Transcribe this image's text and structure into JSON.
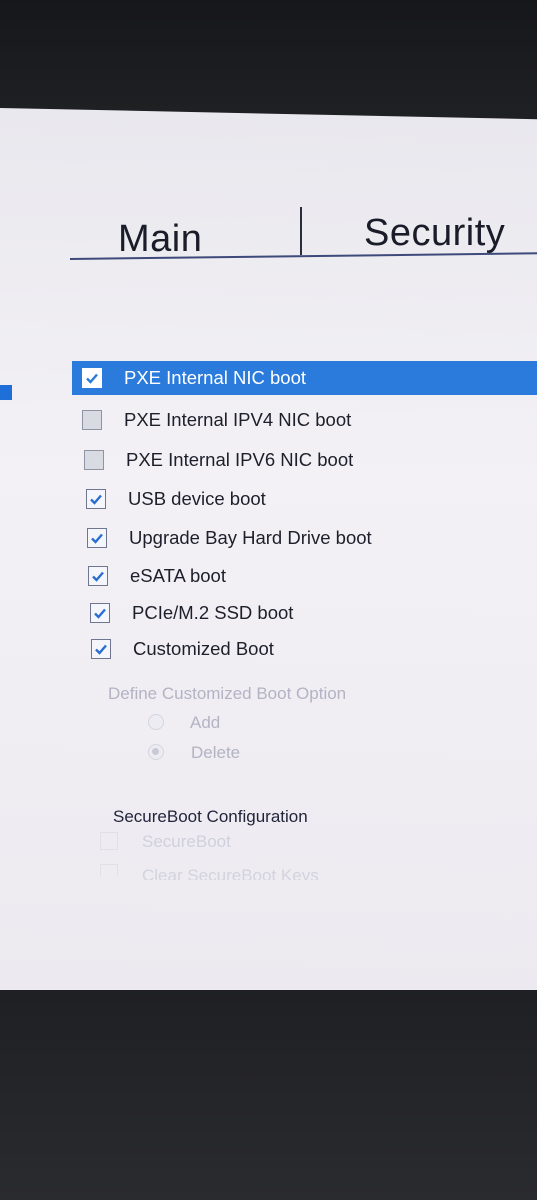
{
  "tabs": {
    "main": "Main",
    "security": "Security"
  },
  "boot_options": [
    {
      "label": "PXE Internal NIC boot",
      "checked": true,
      "selected": true
    },
    {
      "label": "PXE Internal IPV4 NIC boot",
      "checked": false,
      "selected": false
    },
    {
      "label": "PXE Internal IPV6 NIC boot",
      "checked": false,
      "selected": false
    },
    {
      "label": "USB device boot",
      "checked": true,
      "selected": false
    },
    {
      "label": "Upgrade Bay Hard Drive boot",
      "checked": true,
      "selected": false
    },
    {
      "label": "eSATA boot",
      "checked": true,
      "selected": false
    },
    {
      "label": "PCIe/M.2 SSD boot",
      "checked": true,
      "selected": false
    },
    {
      "label": "Customized Boot",
      "checked": true,
      "selected": false
    }
  ],
  "custom_boot": {
    "title": "Define Customized Boot Option",
    "add_label": "Add",
    "delete_label": "Delete",
    "selected_radio": "Delete"
  },
  "secure_boot": {
    "title": "SecureBoot Configuration",
    "secureboot_label": "SecureBoot",
    "clear_keys_label": "Clear SecureBoot Keys"
  },
  "colors": {
    "selection": "#2a7bdc",
    "accent": "#3d4a7a"
  }
}
